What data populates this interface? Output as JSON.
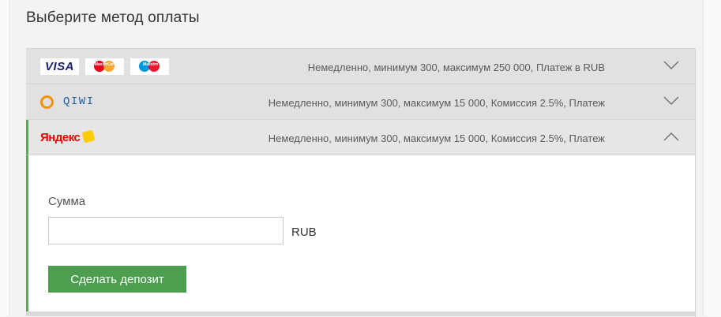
{
  "page": {
    "title": "Выберите метод оплаты"
  },
  "methods": [
    {
      "id": "cards",
      "logos": [
        "VISA",
        "MasterCard",
        "Maestro"
      ],
      "info": "Немедленно, минимум 300, максимум 250 000, Платеж в RUB",
      "expanded": false
    },
    {
      "id": "qiwi",
      "logo_text": "QIWI",
      "info": "Немедленно, минимум 300, максимум 15 000, Комиссия 2.5%, Платеж",
      "expanded": false
    },
    {
      "id": "yandex",
      "logo_text": "Яндекс",
      "info": "Немедленно, минимум 300, максимум 15 000, Комиссия 2.5%, Платеж",
      "expanded": true
    }
  ],
  "form": {
    "amount_label": "Сумма",
    "amount_value": "",
    "currency": "RUB",
    "submit_label": "Сделать депозит"
  },
  "colors": {
    "accent_green": "#4e9e4f",
    "row_bg": "#e1e1e1",
    "visa_blue": "#1a1f71",
    "qiwi_orange": "#f39200",
    "qiwi_blue": "#1b5e9e",
    "yandex_red": "#e60000",
    "yandex_yellow": "#ffcc00"
  }
}
